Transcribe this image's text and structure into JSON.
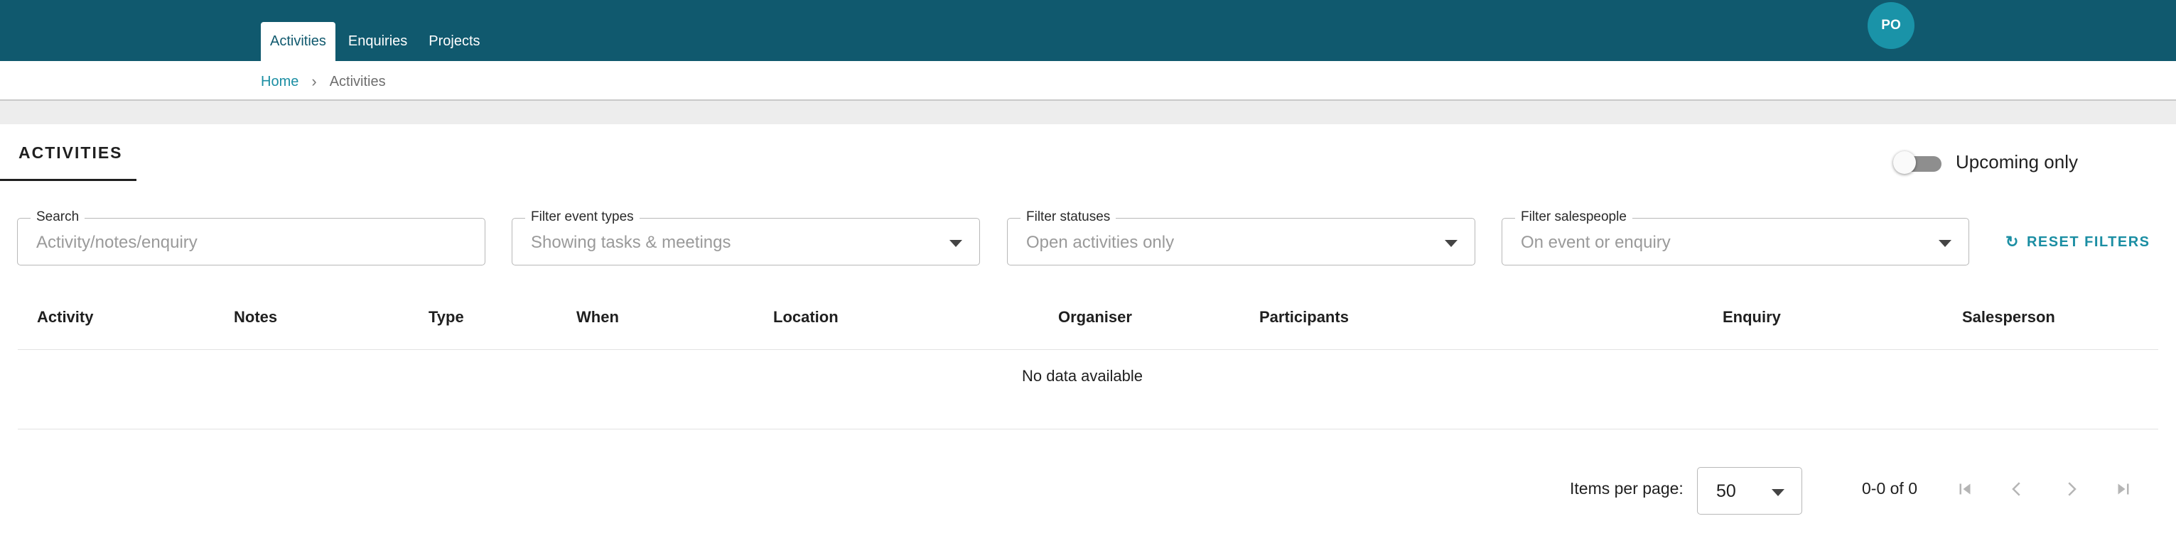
{
  "nav": {
    "tabs": [
      {
        "label": "Activities",
        "active": true
      },
      {
        "label": "Enquiries",
        "active": false
      },
      {
        "label": "Projects",
        "active": false
      }
    ],
    "user_initials": "PO"
  },
  "breadcrumb": {
    "home": "Home",
    "current": "Activities"
  },
  "card": {
    "title": "ACTIVITIES",
    "upcoming_label": "Upcoming only",
    "upcoming_on": false
  },
  "filters": {
    "search": {
      "label": "Search",
      "placeholder": "Activity/notes/enquiry"
    },
    "event_types": {
      "label": "Filter event types",
      "value": "Showing tasks & meetings"
    },
    "statuses": {
      "label": "Filter statuses",
      "value": "Open activities only"
    },
    "salespeople": {
      "label": "Filter salespeople",
      "value": "On event or enquiry"
    },
    "reset_label": "RESET FILTERS"
  },
  "table": {
    "columns": [
      "Activity",
      "Notes",
      "Type",
      "When",
      "Location",
      "Organiser",
      "Participants",
      "Enquiry",
      "Salesperson"
    ],
    "empty_text": "No data available"
  },
  "pagination": {
    "items_per_page_label": "Items per page:",
    "items_per_page": "50",
    "range_text": "0-0 of 0"
  },
  "colors": {
    "header_bg": "#10596e",
    "accent": "#1b8ea3",
    "avatar_bg": "#1a93a8"
  },
  "icons": {
    "reset": "refresh-icon",
    "first_page": "first-page-icon",
    "prev_page": "chevron-left-icon",
    "next_page": "chevron-right-icon",
    "last_page": "last-page-icon"
  }
}
